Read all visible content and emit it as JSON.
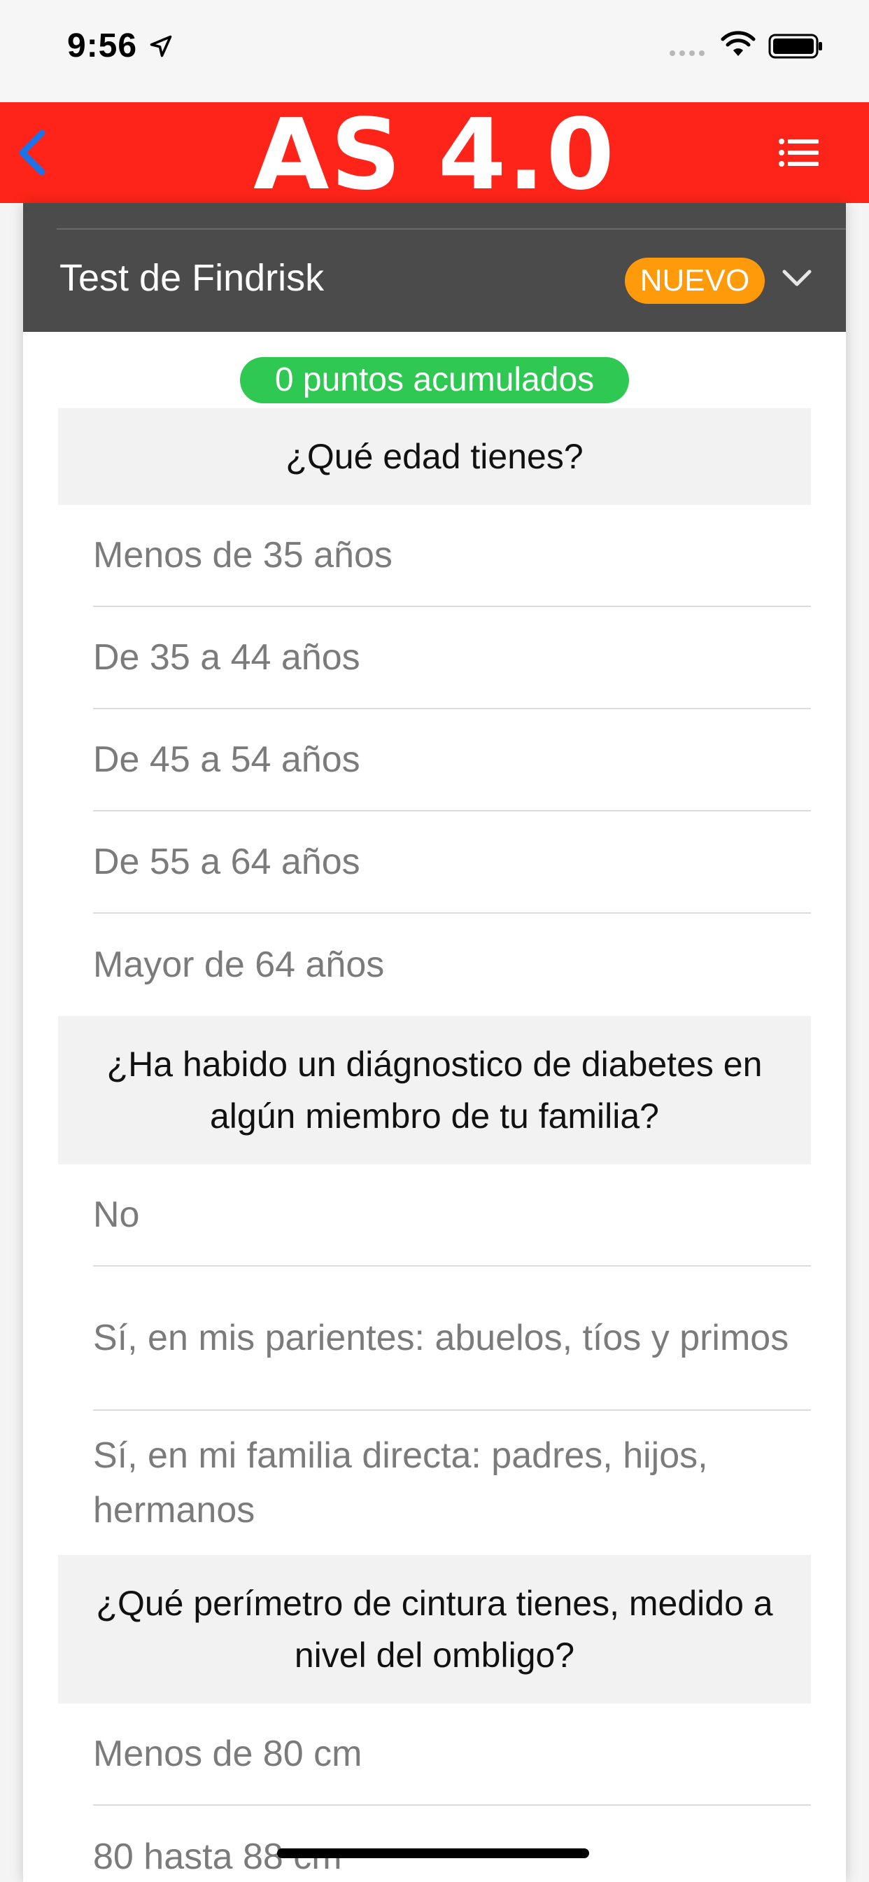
{
  "status_bar": {
    "time": "9:56"
  },
  "nav": {
    "logo": "AS 4.0"
  },
  "card": {
    "title": "Test de Findrisk",
    "badge": "NUEVO",
    "points": "0 puntos acumulados",
    "questions": [
      {
        "question": "¿Qué edad tienes?",
        "answers": [
          "Menos de 35 años",
          "De 35 a 44 años",
          "De 45 a 54 años",
          "De 55 a 64 años",
          "Mayor de 64 años"
        ]
      },
      {
        "question": "¿Ha habido un diágnostico de diabetes en algún miembro de tu familia?",
        "answers": [
          "No",
          "Sí, en mis parientes: abuelos, tíos y primos",
          "Sí, en mi familia directa: padres, hijos, hermanos"
        ]
      },
      {
        "question": "¿Qué perímetro de cintura tienes, medido a nivel del ombligo?",
        "answers": [
          "Menos de 80 cm",
          "80 hasta 88 cm"
        ]
      }
    ]
  },
  "colors": {
    "nav_red": "#ff2419",
    "header_gray": "#4b4b4b",
    "badge_orange": "#ff9a0a",
    "points_green": "#2fc852",
    "back_blue": "#1a73e8"
  },
  "icons": [
    "location-arrow-icon",
    "signal-icon",
    "wifi-icon",
    "battery-icon",
    "back-chevron-icon",
    "menu-list-icon",
    "chevron-down-icon"
  ]
}
